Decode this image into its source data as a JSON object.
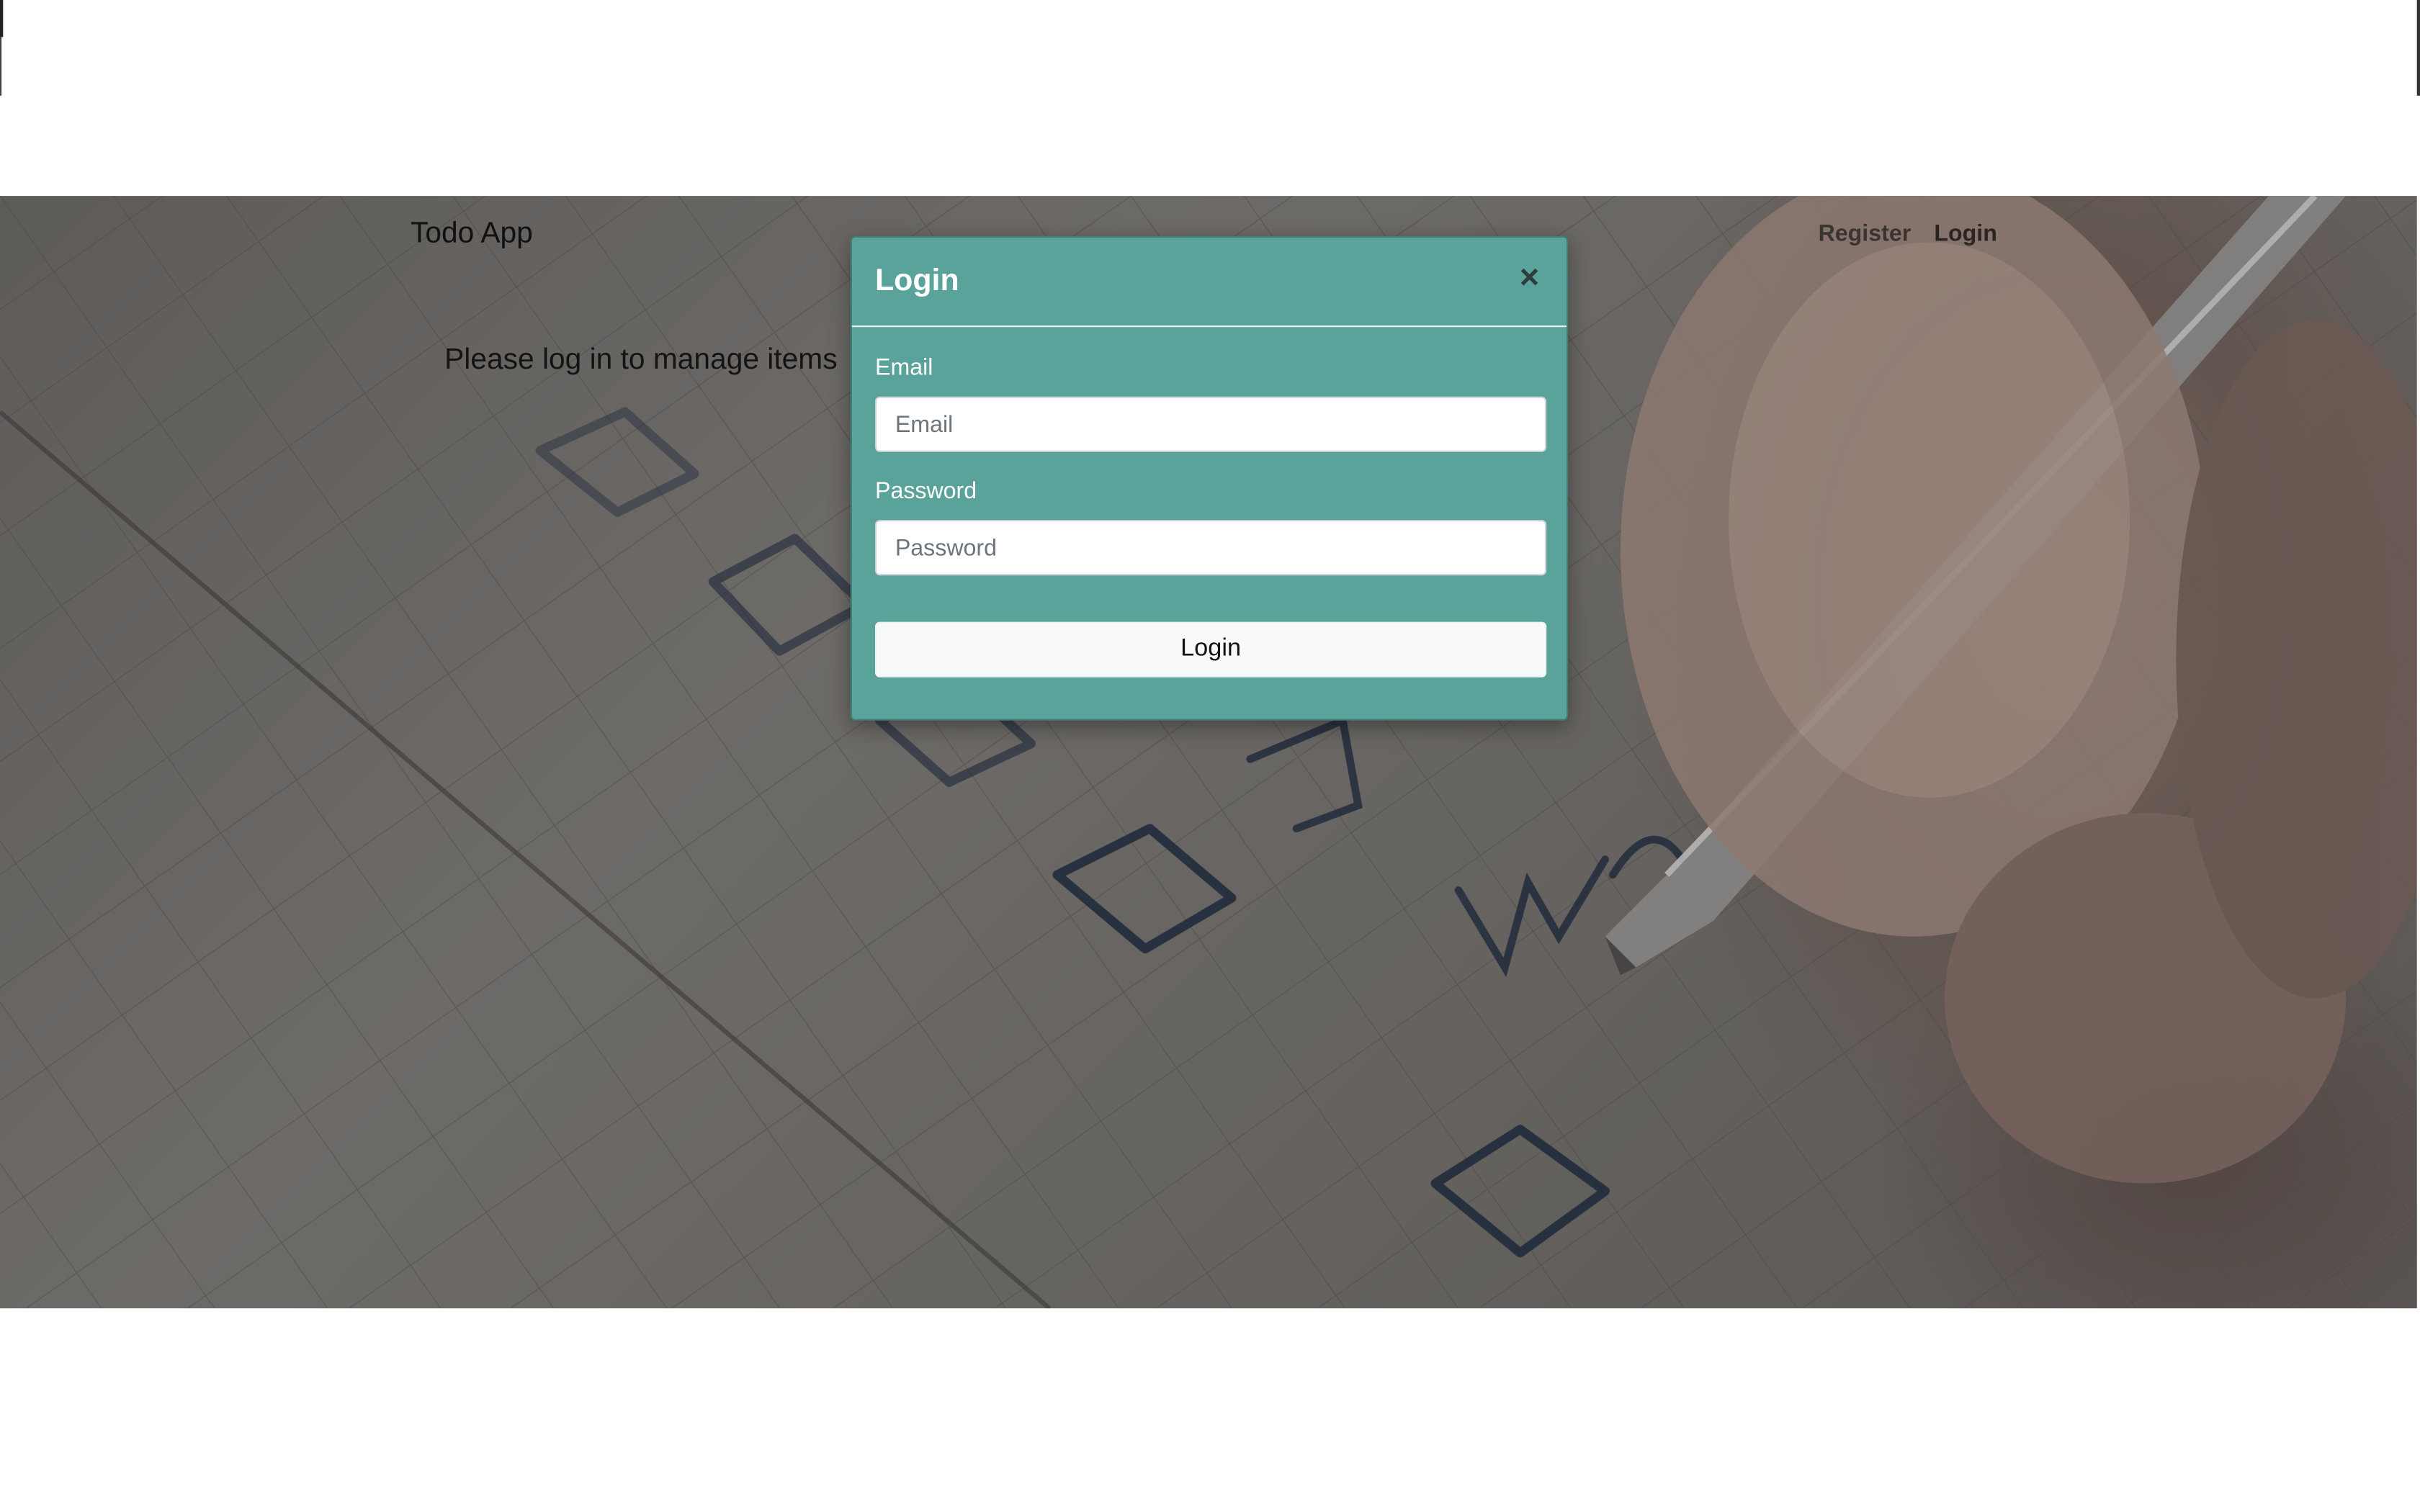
{
  "navbar": {
    "brand": "Todo App",
    "links": [
      {
        "label": "Register"
      },
      {
        "label": "Login"
      }
    ]
  },
  "main": {
    "prompt": "Please log in to manage items"
  },
  "modal": {
    "title": "Login",
    "close_symbol": "×",
    "fields": [
      {
        "label": "Email",
        "placeholder": "Email",
        "value": ""
      },
      {
        "label": "Password",
        "placeholder": "Password",
        "value": ""
      }
    ],
    "submit_label": "Login"
  },
  "colors": {
    "modal_background": "#5aa39b",
    "button_background": "#f8f9fa"
  },
  "icons": {
    "close": "close-icon"
  }
}
